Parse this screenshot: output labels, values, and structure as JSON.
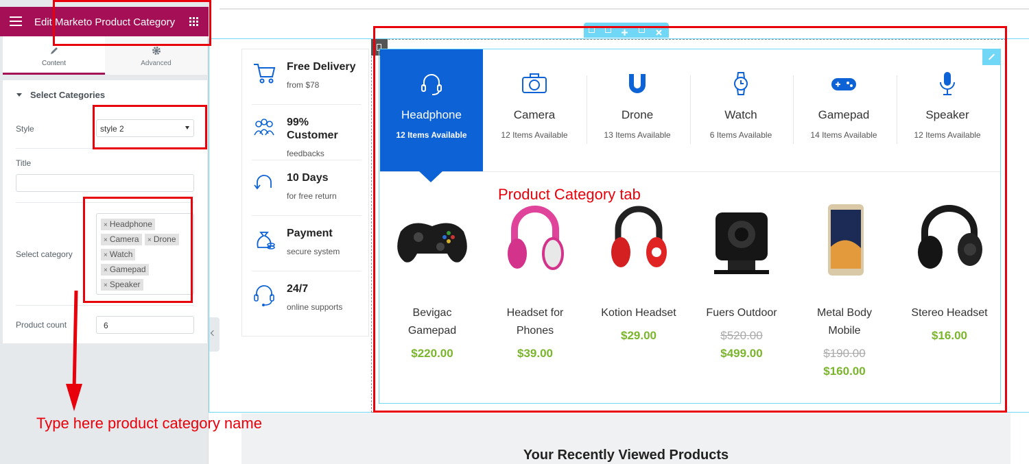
{
  "editor": {
    "title": "Edit Marketo Product Category",
    "tabs": [
      {
        "label": "Content"
      },
      {
        "label": "Advanced"
      }
    ],
    "section_title": "Select Categories",
    "style_label": "Style",
    "style_value": "style 2",
    "title_label": "Title",
    "title_value": "",
    "category_label": "Select category",
    "categories": [
      "Headphone",
      "Camera",
      "Drone",
      "Watch",
      "Gamepad",
      "Speaker"
    ],
    "tag_remove": "×",
    "count_label": "Product count",
    "count_value": "6"
  },
  "annotations": {
    "type_here": "Type here product category name",
    "tab_label": "Product Category tab",
    "color": "#e8000b"
  },
  "features": [
    {
      "title": "Free Delivery",
      "subtitle": "from $78",
      "icon": "cart-icon"
    },
    {
      "title": "99% Customer",
      "subtitle": "feedbacks",
      "icon": "customers-icon"
    },
    {
      "title": "10 Days",
      "subtitle": "for free return",
      "icon": "return-icon"
    },
    {
      "title": "Payment",
      "subtitle": "secure system",
      "icon": "money-bag-icon"
    },
    {
      "title": "24/7",
      "subtitle": "online supports",
      "icon": "headset-support-icon"
    }
  ],
  "category_tabs": [
    {
      "name": "Headphone",
      "count": "12 Items Available",
      "icon": "headphone-icon",
      "active": true
    },
    {
      "name": "Camera",
      "count": "12 Items Available",
      "icon": "camera-icon"
    },
    {
      "name": "Drone",
      "count": "13 Items Available",
      "icon": "drone-icon"
    },
    {
      "name": "Watch",
      "count": "6 Items Available",
      "icon": "watch-icon"
    },
    {
      "name": "Gamepad",
      "count": "14 Items Available",
      "icon": "gamepad-icon"
    },
    {
      "name": "Speaker",
      "count": "12 Items Available",
      "icon": "microphone-icon"
    }
  ],
  "products": [
    {
      "name_l1": "Bevigac",
      "name_l2": "Gamepad",
      "old_price": "",
      "price": "$220.00"
    },
    {
      "name_l1": "Headset for",
      "name_l2": "Phones",
      "old_price": "",
      "price": "$39.00"
    },
    {
      "name_l1": "Kotion Headset",
      "name_l2": "",
      "old_price": "",
      "price": "$29.00"
    },
    {
      "name_l1": "Fuers Outdoor",
      "name_l2": "",
      "old_price": "$520.00",
      "price": "$499.00"
    },
    {
      "name_l1": "Metal Body",
      "name_l2": "Mobile",
      "old_price": "$190.00",
      "price": "$160.00"
    },
    {
      "name_l1": "Stereo Headset",
      "name_l2": "",
      "old_price": "",
      "price": "$16.00"
    }
  ],
  "recent_title": "Your Recently Viewed Products",
  "colors": {
    "brand": "#a50f55",
    "active_tab": "#0d62d6",
    "price": "#7ab52c",
    "editor_outline": "#71d7f7"
  }
}
